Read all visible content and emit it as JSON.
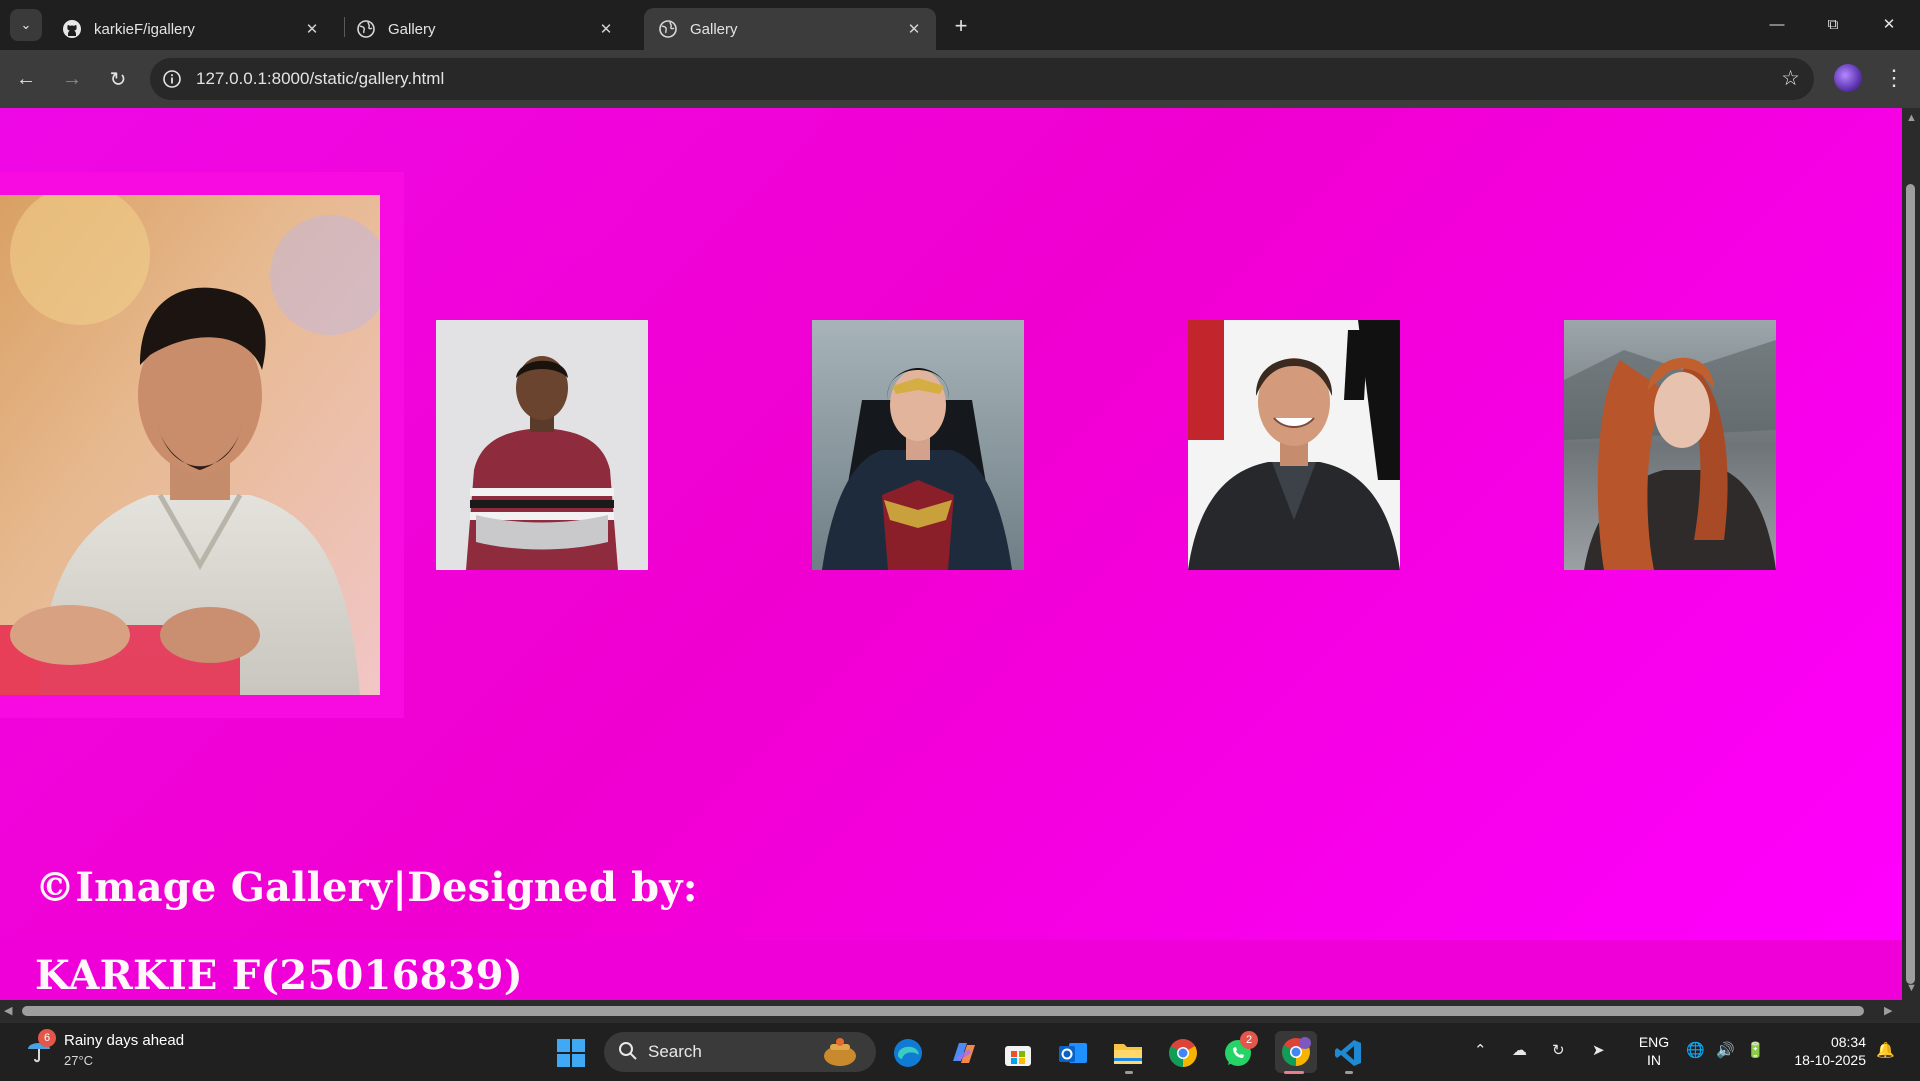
{
  "browser": {
    "tabs": [
      {
        "title": "karkieF/igallery",
        "icon": "github-icon",
        "active": false
      },
      {
        "title": "Gallery",
        "icon": "globe-icon",
        "active": false
      },
      {
        "title": "Gallery",
        "icon": "globe-icon",
        "active": true
      }
    ],
    "url": "127.0.0.1:8000/static/gallery.html"
  },
  "page": {
    "background_color": "#f000d8",
    "gallery": [
      {
        "subject": "man-white-shirt",
        "size": "large"
      },
      {
        "subject": "young-man-maroon-tshirt",
        "size": "small"
      },
      {
        "subject": "wonder-woman",
        "size": "small"
      },
      {
        "subject": "smiling-man-dark-suit",
        "size": "small"
      },
      {
        "subject": "red-haired-woman",
        "size": "small"
      }
    ],
    "footer": {
      "line1": "©Image Gallery|Designed by:",
      "line2": "KARKIE F(25016839)"
    }
  },
  "taskbar": {
    "weather": {
      "badge": "6",
      "title": "Rainy days ahead",
      "temp": "27°C"
    },
    "search_label": "Search",
    "whatsapp_badge": "2",
    "lang": {
      "line1": "ENG",
      "line2": "IN"
    },
    "clock": {
      "time": "08:34",
      "date": "18-10-2025"
    }
  }
}
